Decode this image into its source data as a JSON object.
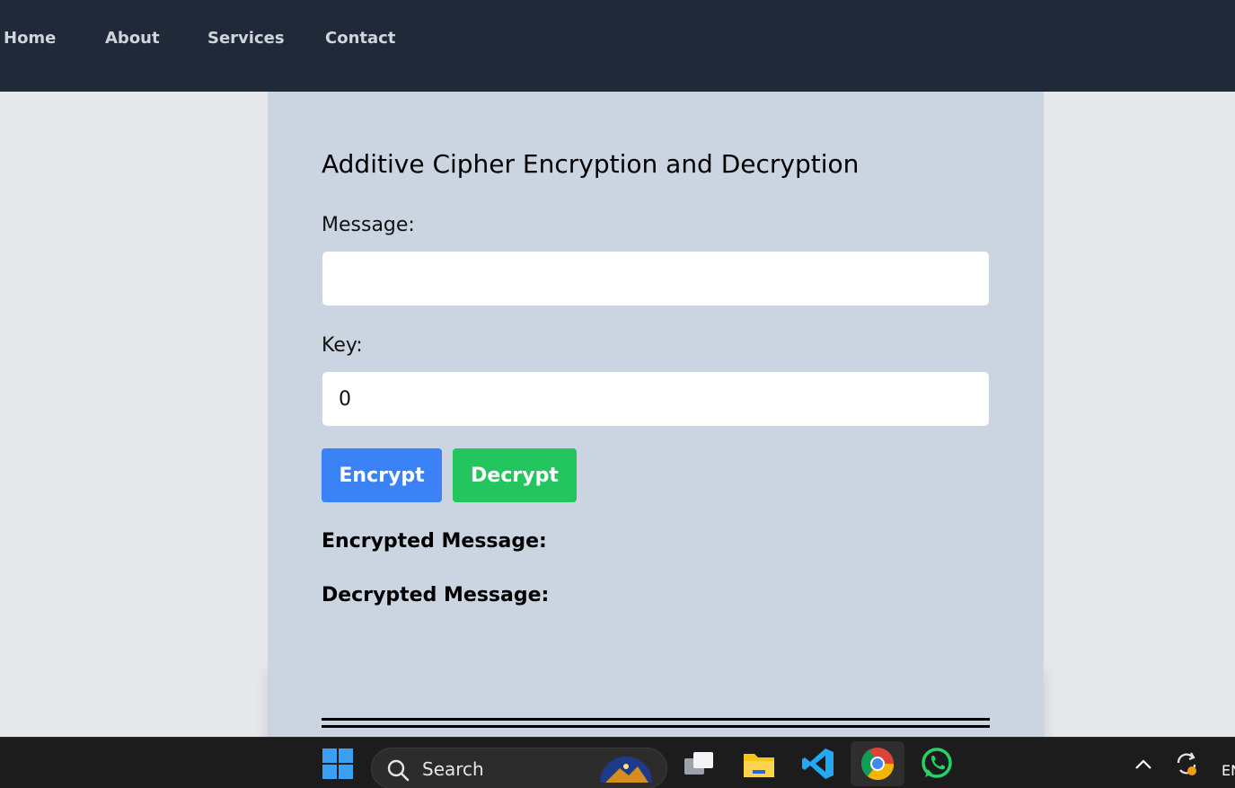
{
  "nav": {
    "items": [
      {
        "label": "Home"
      },
      {
        "label": "About"
      },
      {
        "label": "Services"
      },
      {
        "label": "Contact"
      }
    ]
  },
  "form": {
    "title": "Additive Cipher Encryption and Decryption",
    "message_label": "Message:",
    "message_value": "",
    "key_label": "Key:",
    "key_value": "0",
    "encrypt_label": "Encrypt",
    "decrypt_label": "Decrypt",
    "encrypted_label": "Encrypted Message:",
    "decrypted_label": "Decrypted Message:"
  },
  "taskbar": {
    "search_label": "Search",
    "tray_language": "EN",
    "icons": [
      "windows-start-icon",
      "search-icon",
      "task-view-icon",
      "file-explorer-icon",
      "vscode-icon",
      "chrome-icon",
      "whatsapp-icon",
      "chevron-up-icon",
      "sync-icon"
    ]
  },
  "colors": {
    "nav_bg": "#1f2937",
    "panel_bg": "#cbd5e1",
    "page_bg": "#e5e7eb",
    "encrypt_btn": "#3b82f6",
    "decrypt_btn": "#22c55e"
  }
}
